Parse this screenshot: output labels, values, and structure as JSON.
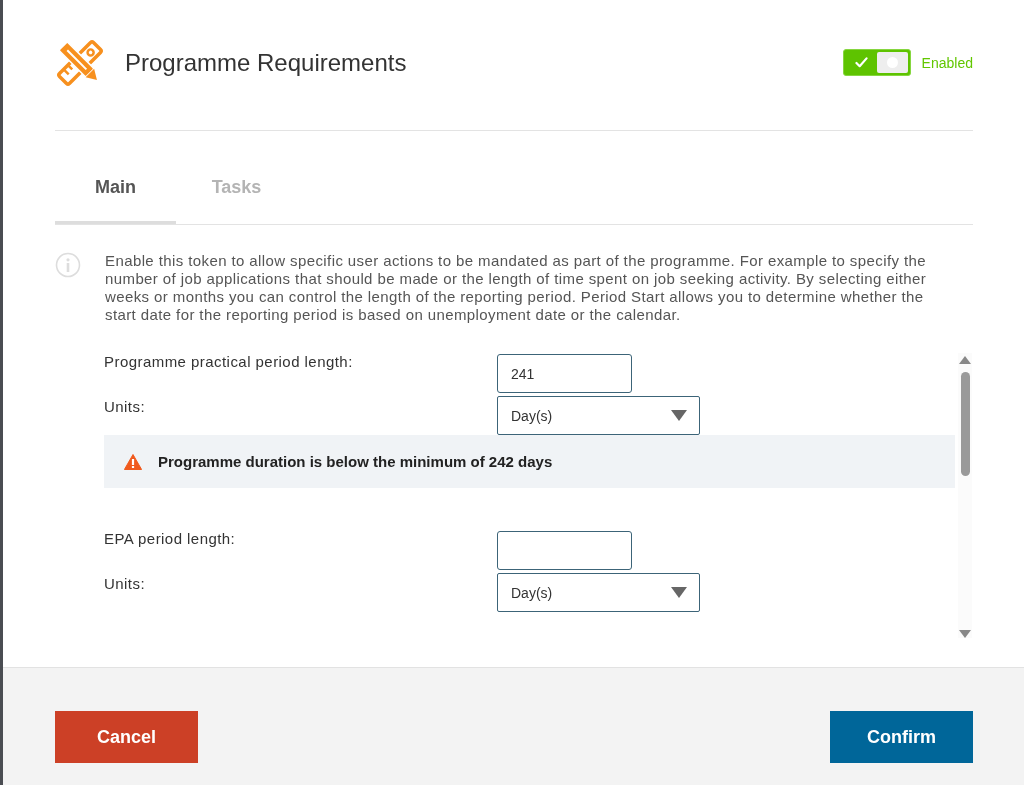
{
  "header": {
    "title": "Programme Requirements",
    "toggle": {
      "on": true,
      "label": "Enabled"
    }
  },
  "tabs": [
    {
      "label": "Main",
      "selected": true,
      "disabled": false
    },
    {
      "label": "Tasks",
      "selected": false,
      "disabled": true
    }
  ],
  "description": "Enable this token to allow specific user actions to be mandated as part of the programme. For example to specify the number of job applications that should be made or the length of time spent on job seeking activity. By selecting either weeks or months you can control the length of the reporting period. Period Start allows you to determine whether the start date for the reporting period is based on unemployment date or the calendar.",
  "form": {
    "rows": [
      {
        "kind": "input",
        "label": "Programme practical period length:",
        "value": "241"
      },
      {
        "kind": "select",
        "label": "Units:",
        "value": "Day(s)"
      },
      {
        "kind": "warning",
        "text": "Programme duration is below the minimum of 242 days"
      },
      {
        "kind": "input",
        "label": "EPA period length:"
      },
      {
        "kind": "select",
        "label": "Units:",
        "value": "Day(s)"
      }
    ]
  },
  "buttons": [
    {
      "kind": "cancel",
      "label": "Cancel"
    },
    {
      "kind": "confirm",
      "label": "Confirm"
    }
  ]
}
